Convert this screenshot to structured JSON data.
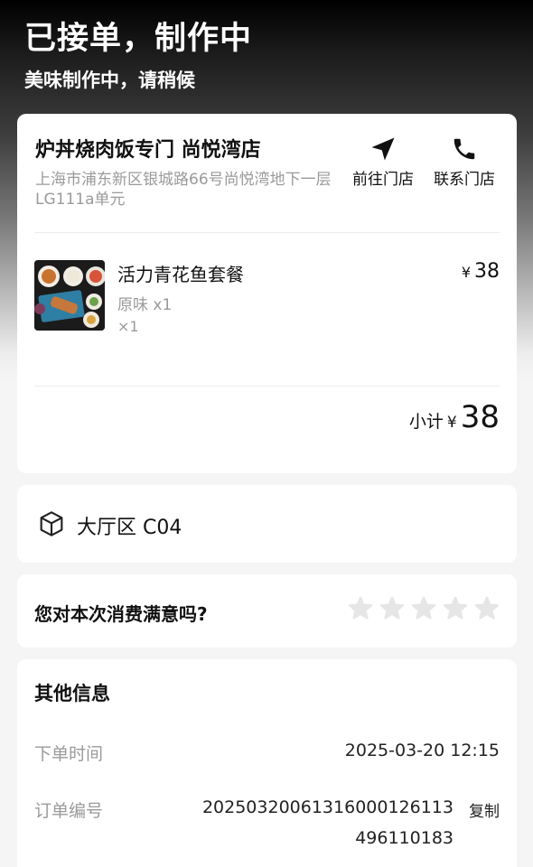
{
  "header": {
    "title": "已接单，制作中",
    "subtitle": "美味制作中，请稍候"
  },
  "store": {
    "name": "炉丼烧肉饭专门 尚悦湾店",
    "address": "上海市浦东新区银城路66号尚悦湾地下一层LG111a单元",
    "actions": {
      "navigate_label": "前往门店",
      "call_label": "联系门店"
    }
  },
  "order_item": {
    "name": "活力青花鱼套餐",
    "spec": "原味 x1",
    "qty": "×1",
    "currency": "¥",
    "price": "38"
  },
  "subtotal": {
    "label": "小计",
    "currency": "¥",
    "value": "38"
  },
  "table": {
    "text": "大厅区 C04"
  },
  "rating": {
    "question": "您对本次消费满意吗?",
    "max_stars": 5,
    "selected_stars": 0,
    "star_color": "#e6e6e6"
  },
  "info": {
    "title": "其他信息",
    "order_time_label": "下单时间",
    "order_time_value": "2025-03-20 12:15",
    "order_no_label": "订单编号",
    "order_no_line1": "20250320061316000126113",
    "order_no_line2": "496110183",
    "copy_label": "复制"
  },
  "colors": {
    "text_primary": "#111111",
    "text_secondary": "#9a9a9a",
    "card_bg": "#ffffff",
    "page_bg": "#f5f5f5"
  }
}
